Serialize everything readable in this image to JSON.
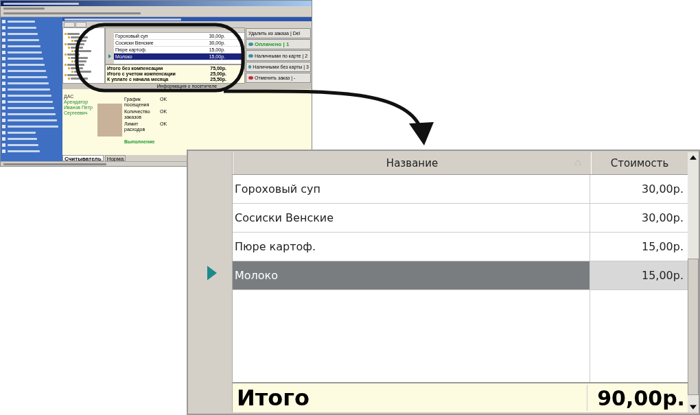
{
  "overview_screenshot": {
    "order_table": {
      "rows": [
        {
          "name": "Гороховый суп",
          "price": "30,00р.",
          "selected": false
        },
        {
          "name": "Сосиски Венские",
          "price": "30,00р.",
          "selected": false
        },
        {
          "name": "Пюре картоф.",
          "price": "15,00р.",
          "selected": false
        },
        {
          "name": "Молоко",
          "price": "15,00р.",
          "selected": true
        }
      ]
    },
    "totals": [
      {
        "label": "Итого без компенсации",
        "value": "75,00р."
      },
      {
        "label": "Итого с учетом компенсации",
        "value": "25,00р."
      },
      {
        "label": "К уплате с начала месяца",
        "value": "25,50р."
      }
    ],
    "actions": [
      {
        "kind": "plain",
        "label": "Удалить из заказа | Del"
      },
      {
        "kind": "status",
        "label": "Оплачено | 1"
      },
      {
        "kind": "payment",
        "label": "Наличными по карте | 2"
      },
      {
        "kind": "payment",
        "label": "Наличными без карты | 3"
      },
      {
        "kind": "cancel",
        "label": "Отменить заказ | -"
      }
    ],
    "info_panel": {
      "title": "Информация о посетителе",
      "person": [
        "ДАС",
        "Арендатор",
        "Иванов Петр Сергеевич"
      ],
      "checks": [
        {
          "label": "График посещения",
          "status": "OK"
        },
        {
          "label": "Количество заказов",
          "status": "OK"
        },
        {
          "label": "Лимит расходов",
          "status": "OK"
        }
      ],
      "message": "Выполнение"
    },
    "bottom_tabs": [
      {
        "label": "Считыватель",
        "selected": true
      },
      {
        "label": "Норма",
        "selected": false
      }
    ]
  },
  "zoomed_table": {
    "columns": [
      {
        "label": "Название",
        "sorted": true
      },
      {
        "label": "Стоимость",
        "sorted": false
      }
    ],
    "rows": [
      {
        "name": "Гороховый суп",
        "price": "30,00р.",
        "selected": false
      },
      {
        "name": "Сосиски Венские",
        "price": "30,00р.",
        "selected": false
      },
      {
        "name": "Пюре картоф.",
        "price": "15,00р.",
        "selected": false
      },
      {
        "name": "Молоко",
        "price": "15,00р.",
        "selected": true
      }
    ],
    "total": {
      "label": "Итого",
      "value": "90,00р."
    }
  }
}
